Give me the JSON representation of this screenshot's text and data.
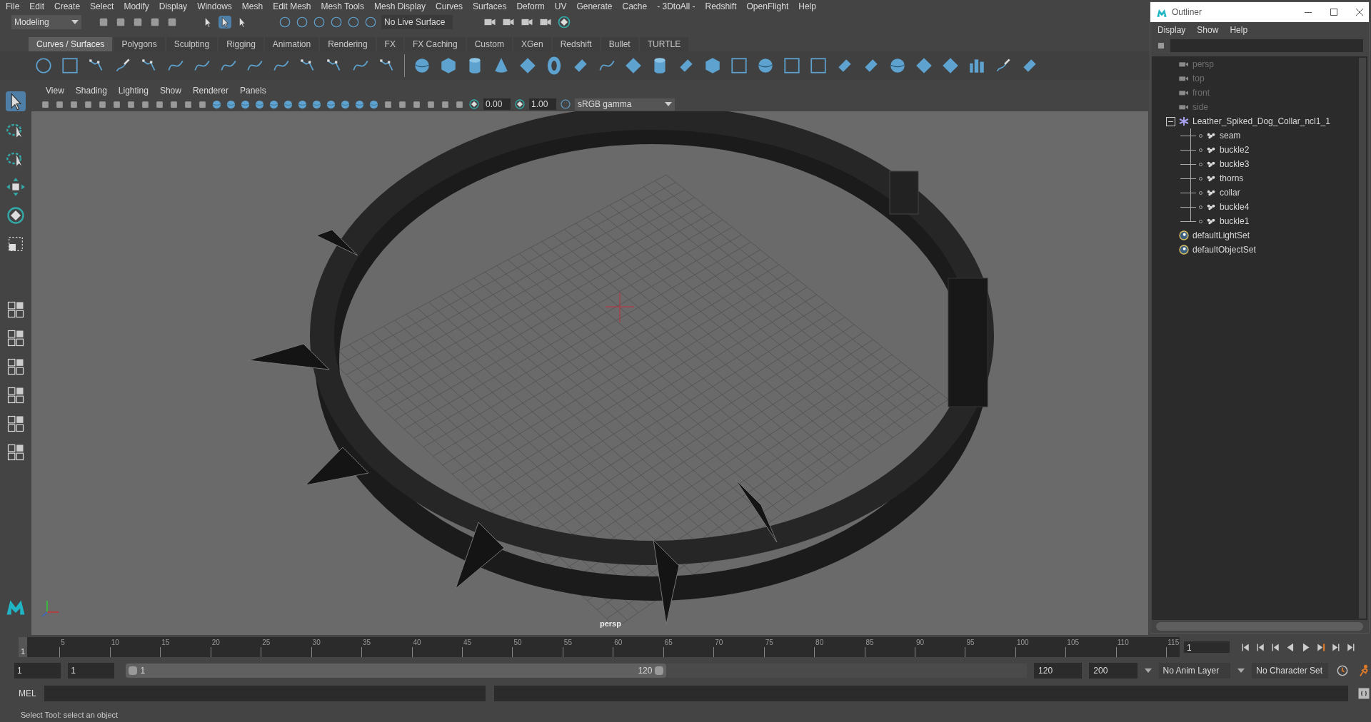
{
  "menu_bar": [
    "File",
    "Edit",
    "Create",
    "Select",
    "Modify",
    "Display",
    "Windows",
    "Mesh",
    "Edit Mesh",
    "Mesh Tools",
    "Mesh Display",
    "Curves",
    "Surfaces",
    "Deform",
    "UV",
    "Generate",
    "Cache",
    "- 3DtoAll -",
    "Redshift",
    "OpenFlight",
    "Help"
  ],
  "status_line": {
    "mode": "Modeling",
    "live_surface": "No Live Surface"
  },
  "shelf": {
    "tabs": [
      {
        "label": "Curves / Surfaces",
        "selected": true
      },
      {
        "label": "Polygons",
        "selected": false
      },
      {
        "label": "Sculpting",
        "selected": false
      },
      {
        "label": "Rigging",
        "selected": false
      },
      {
        "label": "Animation",
        "selected": false
      },
      {
        "label": "Rendering",
        "selected": false
      },
      {
        "label": "FX",
        "selected": false
      },
      {
        "label": "FX Caching",
        "selected": false
      },
      {
        "label": "Custom",
        "selected": false
      },
      {
        "label": "XGen",
        "selected": false
      },
      {
        "label": "Redshift",
        "selected": false
      },
      {
        "label": "Bullet",
        "selected": false
      },
      {
        "label": "TURTLE",
        "selected": false
      }
    ]
  },
  "viewport": {
    "menu": [
      "View",
      "Shading",
      "Lighting",
      "Show",
      "Renderer",
      "Panels"
    ],
    "exposure": "0.00",
    "gamma": "1.00",
    "color_space": "sRGB gamma",
    "camera_label": "persp"
  },
  "outliner": {
    "title": "Outliner",
    "menu": [
      "Display",
      "Show",
      "Help"
    ],
    "items": [
      {
        "label": "persp",
        "kind": "camera",
        "hidden": true
      },
      {
        "label": "top",
        "kind": "camera",
        "hidden": true
      },
      {
        "label": "front",
        "kind": "camera",
        "hidden": true
      },
      {
        "label": "side",
        "kind": "camera",
        "hidden": true
      },
      {
        "label": "Leather_Spiked_Dog_Collar_ncl1_1",
        "kind": "group",
        "hidden": false,
        "expanded": true,
        "children": [
          {
            "label": "seam",
            "kind": "mesh",
            "hidden": false
          },
          {
            "label": "buckle2",
            "kind": "mesh",
            "hidden": false
          },
          {
            "label": "buckle3",
            "kind": "mesh",
            "hidden": false
          },
          {
            "label": "thorns",
            "kind": "mesh",
            "hidden": false
          },
          {
            "label": "collar",
            "kind": "mesh",
            "hidden": false
          },
          {
            "label": "buckle4",
            "kind": "mesh",
            "hidden": false
          },
          {
            "label": "buckle1",
            "kind": "mesh",
            "hidden": false
          }
        ]
      },
      {
        "label": "defaultLightSet",
        "kind": "set",
        "hidden": false
      },
      {
        "label": "defaultObjectSet",
        "kind": "set",
        "hidden": false
      }
    ]
  },
  "time_slider": {
    "current_frame": "1",
    "level": 0,
    "ticks": [
      "5",
      "10",
      "15",
      "20",
      "25",
      "30",
      "35",
      "40",
      "45",
      "50",
      "55",
      "60",
      "65",
      "70",
      "75",
      "80",
      "85",
      "90",
      "95",
      "100",
      "105",
      "110",
      "115"
    ]
  },
  "playback": {
    "current_frame": "1"
  },
  "range": {
    "level": 0.6,
    "start": "1",
    "playback_start": "1",
    "slider_start": "1",
    "slider_end": "120",
    "playback_end": "120",
    "end": "200",
    "anim_layer": "No Anim Layer",
    "character_set": "No Character Set"
  },
  "command_line": {
    "label": "MEL"
  },
  "help_line": "Select Tool: select an object"
}
